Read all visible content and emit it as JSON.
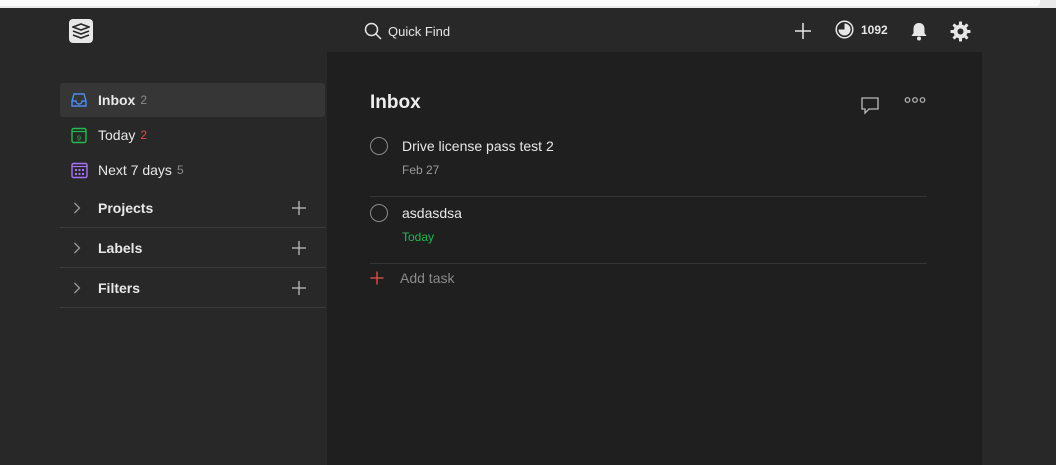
{
  "app": {
    "accent": "#de4c4a",
    "green": "#25b84c"
  },
  "topbar": {
    "logo_icon": "todoist-logo-icon",
    "search_placeholder": "Quick Find",
    "karma_value": "1092",
    "icons": [
      "plus-icon",
      "karma-icon",
      "bell-icon",
      "gear-icon"
    ]
  },
  "sidebar": {
    "items": [
      {
        "label": "Inbox",
        "count": "2",
        "icon": "inbox-icon",
        "active": true
      },
      {
        "label": "Today",
        "count": "2",
        "icon": "today-icon",
        "day": "9"
      },
      {
        "label": "Next 7 days",
        "count": "5",
        "icon": "calendar-icon"
      }
    ],
    "sections": [
      {
        "label": "Projects"
      },
      {
        "label": "Labels"
      },
      {
        "label": "Filters"
      }
    ]
  },
  "main": {
    "title": "Inbox",
    "tasks": [
      {
        "title": "Drive license pass test 2",
        "due": "Feb 27"
      },
      {
        "title": "asdasdsa",
        "due": "Today"
      }
    ],
    "add_task_label": "Add task"
  }
}
